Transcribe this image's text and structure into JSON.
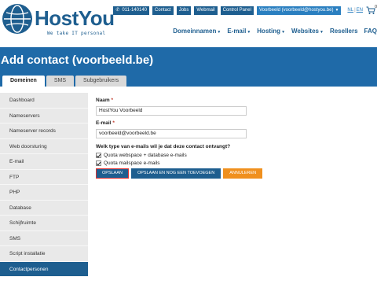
{
  "header": {
    "logo_text": "HostYou",
    "logo_tagline": "We take IT personal",
    "topbar": {
      "phone": "011-140140",
      "links": [
        "Contact",
        "Jobs",
        "Webmail",
        "Control Panel"
      ],
      "user": "Voorbeeld (voorbeeld@hostyou.be)",
      "lang_nl": "NL",
      "lang_en": "EN",
      "cart_count": "0"
    },
    "nav": [
      {
        "label": "Domeinnamen",
        "dropdown": true
      },
      {
        "label": "E-mail",
        "dropdown": true
      },
      {
        "label": "Hosting",
        "dropdown": true
      },
      {
        "label": "Websites",
        "dropdown": true
      },
      {
        "label": "Resellers",
        "dropdown": false
      },
      {
        "label": "FAQ",
        "dropdown": false
      }
    ]
  },
  "page": {
    "title": "Add contact (voorbeeld.be)",
    "tabs": [
      "Domeinen",
      "SMS",
      "Subgebruikers"
    ],
    "active_tab": "Domeinen"
  },
  "sidebar": {
    "items": [
      "Dashboard",
      "Nameservers",
      "Nameserver records",
      "Web doorsturing",
      "E-mail",
      "FTP",
      "PHP",
      "Database",
      "Schijfruimte",
      "SMS",
      "Script installatie",
      "Contactpersonen"
    ],
    "active": "Contactpersonen"
  },
  "form": {
    "name_label": "Naam",
    "name_value": "HostYou Voorbeeld",
    "email_label": "E-mail",
    "email_value": "voorbeeld@voorbeeld.be",
    "required_mark": "*",
    "question": "Welk type van e-mails wil je dat deze contact ontvangt?",
    "options": [
      {
        "label": "Quota webspace + database e-mails",
        "checked": true
      },
      {
        "label": "Quota mailspace e-mails",
        "checked": true
      }
    ]
  },
  "buttons": {
    "save": "OPSLAAN",
    "save_new": "OPSLAAN EN NOG EEN TOEVOEGEN",
    "cancel": "ANNULEREN"
  },
  "colors": {
    "brand_blue": "#1e5e8f",
    "band_blue": "#1f6aa8",
    "orange": "#f0901e"
  }
}
